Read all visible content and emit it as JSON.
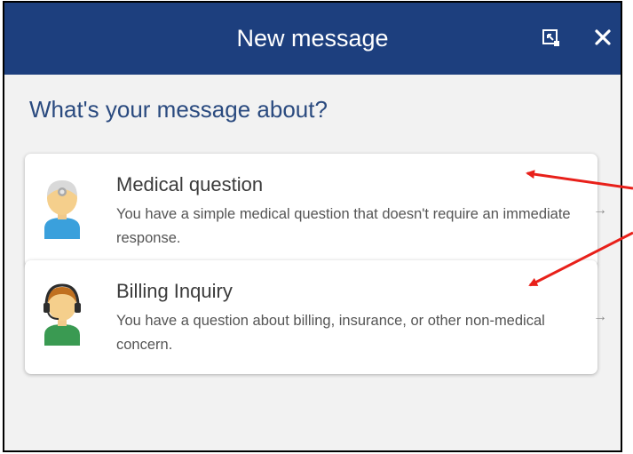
{
  "dialog": {
    "title": "New message",
    "popout_icon": "popout-icon",
    "close_icon": "close-icon",
    "close_label": "✕"
  },
  "main": {
    "question": "What's your message about?",
    "options": [
      {
        "title": "Medical question",
        "description": "You have a simple medical question that doesn't require an immediate response.",
        "icon": "doctor-avatar-icon",
        "arrow": "→"
      },
      {
        "title": "Billing Inquiry",
        "description": "You have a question about billing, insurance, or other non-medical concern.",
        "icon": "support-agent-avatar-icon",
        "arrow": "→"
      }
    ]
  },
  "colors": {
    "header_bg": "#1d3f7e",
    "question_text": "#2a4a7f",
    "annotation_red": "#e8201a"
  }
}
